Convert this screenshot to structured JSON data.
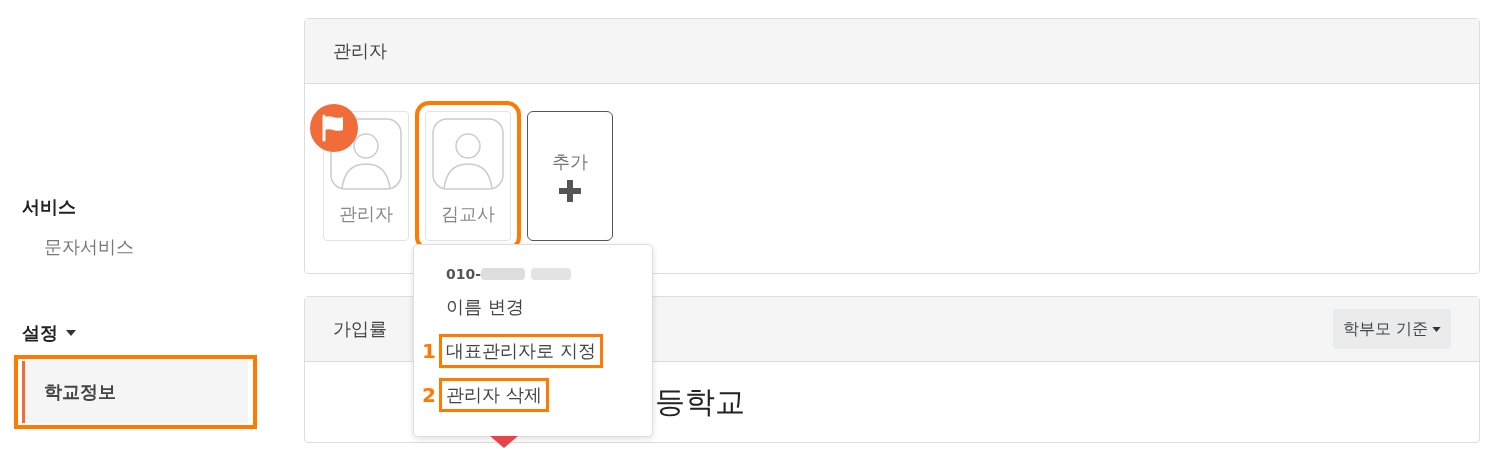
{
  "sidebar": {
    "sections": [
      {
        "title": "서비스",
        "dropdown": false,
        "items": [
          {
            "label": "문자서비스",
            "selected": false,
            "highlighted": false
          }
        ]
      },
      {
        "title": "설정",
        "dropdown": true,
        "items": [
          {
            "label": "학교정보",
            "selected": true,
            "highlighted": true
          }
        ]
      }
    ]
  },
  "admin_panel": {
    "title": "관리자",
    "admins": [
      {
        "name": "관리자",
        "representative": true,
        "highlighted": false
      },
      {
        "name": "김교사",
        "representative": false,
        "highlighted": true
      }
    ],
    "add_button": "추가"
  },
  "admin_menu": {
    "phone": "010-",
    "items": [
      {
        "label": "이름 변경",
        "marker": null,
        "highlighted": false
      },
      {
        "label": "대표관리자로 지정",
        "marker": "1",
        "highlighted": true
      },
      {
        "label": "관리자 삭제",
        "marker": "2",
        "highlighted": true
      }
    ]
  },
  "rate_panel": {
    "title": "가입률",
    "filter": "학부모 기준",
    "school_name": "등학교"
  }
}
